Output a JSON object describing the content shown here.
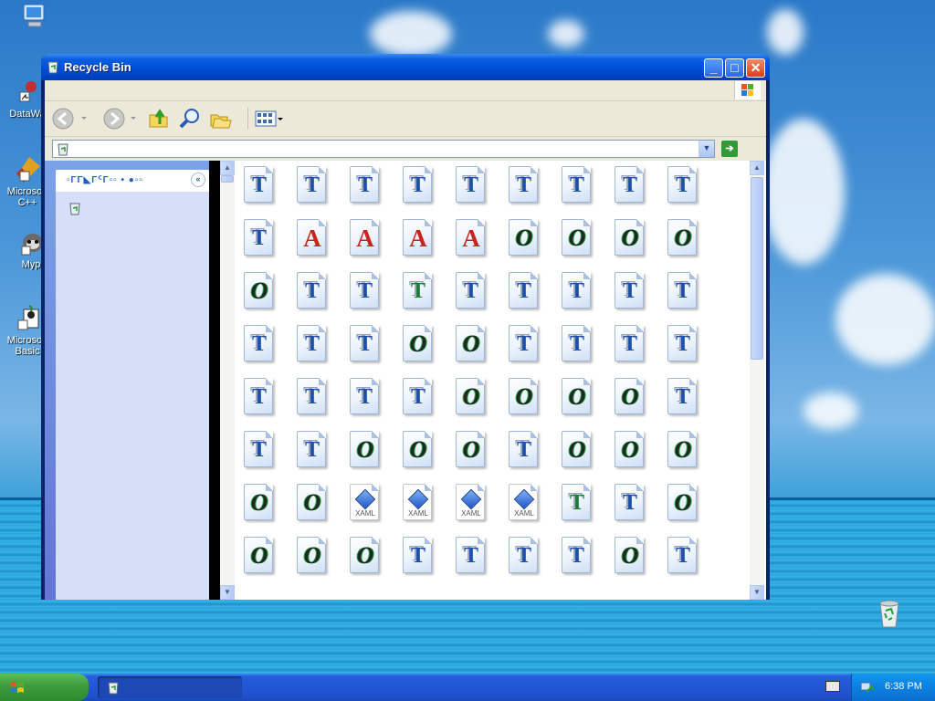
{
  "desktop": {
    "icons": [
      {
        "label": "",
        "name": "desktop-icon-my-computer"
      },
      {
        "label": "DataWa",
        "name": "desktop-icon-datawa"
      },
      {
        "label": "Microsoft\nC++",
        "name": "desktop-icon-microsoft-cpp"
      },
      {
        "label": "Myp",
        "name": "desktop-icon-myp"
      },
      {
        "label": "Microsoft\nBasic",
        "name": "desktop-icon-microsoft-basic"
      }
    ]
  },
  "window": {
    "title": "Recycle Bin",
    "buttons": {
      "minimize": "_",
      "maximize": "□",
      "close": "✕"
    },
    "address": {
      "value": "",
      "dropdown": "▼",
      "go": "➔"
    },
    "task_pane": {
      "heading": "▫ΓΓ◣ΓᑦΓ▫▫ • ●▫▫",
      "collapse": "«"
    },
    "files": [
      "T",
      "T",
      "T",
      "T",
      "T",
      "T",
      "T",
      "T",
      "T",
      "T",
      "A",
      "A",
      "A",
      "A",
      "O",
      "O",
      "O",
      "O",
      "O",
      "T",
      "T",
      "TG",
      "T",
      "T",
      "T",
      "T",
      "T",
      "T",
      "T",
      "T",
      "O",
      "O",
      "T",
      "T",
      "T",
      "T",
      "T",
      "T",
      "T",
      "T",
      "O",
      "O",
      "O",
      "O",
      "T",
      "T",
      "T",
      "O",
      "O",
      "O",
      "T",
      "O",
      "O",
      "O",
      "O",
      "O",
      "X",
      "X",
      "X",
      "X",
      "TG",
      "T",
      "O",
      "O",
      "O",
      "O",
      "T",
      "T",
      "T",
      "T",
      "O",
      "T"
    ],
    "glyphs": {
      "T": "T",
      "TG": "T",
      "A": "A",
      "O": "O",
      "X": "XAML"
    }
  },
  "taskbar": {
    "start_label": "",
    "task_item_label": "",
    "clock": "6:38 PM"
  },
  "colors": {
    "title_bar": "#0050d8",
    "task_pane": "#d6dff7",
    "taskbar": "#245edb",
    "start_button": "#3c9c3c"
  }
}
